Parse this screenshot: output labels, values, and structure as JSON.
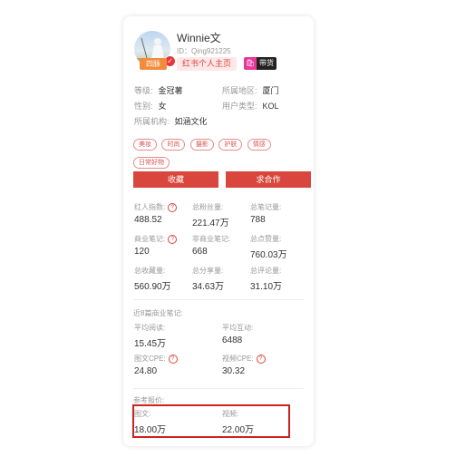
{
  "profile": {
    "name": "Winnie文",
    "id_text": "ID：Qing921225",
    "level_badge": "四脉",
    "verify_mark": "✓",
    "homepage_button": "红书个人主页",
    "goods_icon": "🛍",
    "goods_badge": "带货"
  },
  "info": {
    "level_label": "等级:",
    "level_value": "金冠薯",
    "region_label": "所属地区:",
    "region_value": "厦门",
    "gender_label": "性别:",
    "gender_value": "女",
    "user_type_label": "用户类型:",
    "user_type_value": "KOL",
    "org_label": "所属机构:",
    "org_value": "如涵文化"
  },
  "tags": [
    "美妆",
    "时尚",
    "摄影",
    "护肤",
    "情感",
    "日常好物"
  ],
  "buttons": {
    "collect": "收藏",
    "cooperate": "求合作"
  },
  "stats": [
    {
      "label": "红人指数:",
      "value": "488.52",
      "help": true
    },
    {
      "label": "总粉丝量:",
      "value": "221.47万",
      "help": false
    },
    {
      "label": "总笔记量:",
      "value": "788",
      "help": false
    },
    {
      "label": "商业笔记:",
      "value": "120",
      "help": true
    },
    {
      "label": "非商业笔记:",
      "value": "668",
      "help": false
    },
    {
      "label": "总点赞量:",
      "value": "760.03万",
      "help": false
    },
    {
      "label": "总收藏量:",
      "value": "560.90万",
      "help": false
    },
    {
      "label": "总分享量:",
      "value": "34.63万",
      "help": false
    },
    {
      "label": "总评论量:",
      "value": "31.10万",
      "help": false
    }
  ],
  "recent": {
    "title": "近8篇商业笔记:",
    "avg_read_label": "平均阅读:",
    "avg_read_value": "15.45万",
    "avg_interact_label": "平均互动:",
    "avg_interact_value": "6488",
    "image_cpe_label": "图文CPE:",
    "image_cpe_value": "24.80",
    "video_cpe_label": "视频CPE:",
    "video_cpe_value": "30.32"
  },
  "pricing": {
    "title": "参考报价:",
    "image_label": "图文:",
    "image_value": "18.00万",
    "video_label": "视频:",
    "video_value": "22.00万"
  },
  "help_glyph": "?"
}
